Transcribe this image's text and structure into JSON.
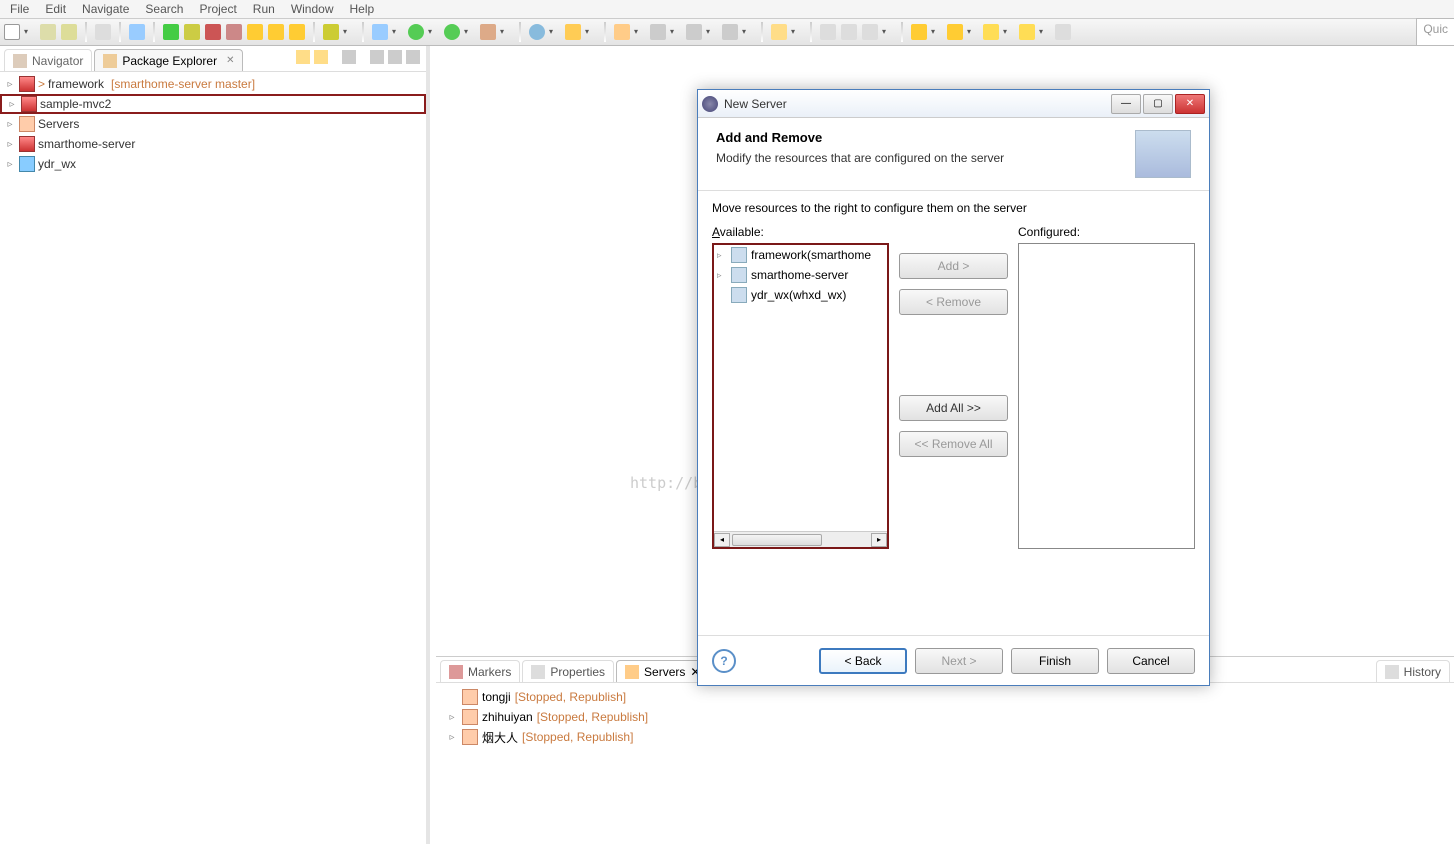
{
  "menu": [
    "File",
    "Edit",
    "Navigate",
    "Search",
    "Project",
    "Run",
    "Window",
    "Help"
  ],
  "quick_placeholder": "Quic",
  "views": {
    "navigator": "Navigator",
    "package_explorer": "Package Explorer"
  },
  "projects": [
    {
      "name": "framework",
      "deco": "[smarthome-server master]",
      "icon": "proj"
    },
    {
      "name": "sample-mvc2",
      "deco": "",
      "icon": "proj",
      "highlight": true
    },
    {
      "name": "Servers",
      "deco": "",
      "icon": "srv"
    },
    {
      "name": "smarthome-server",
      "deco": "",
      "icon": "proj"
    },
    {
      "name": "ydr_wx",
      "deco": "",
      "icon": "war"
    }
  ],
  "bottom_tabs": {
    "markers": "Markers",
    "properties": "Properties",
    "servers": "Servers",
    "history": "History"
  },
  "servers_list": [
    {
      "name": "tongji",
      "status": "[Stopped, Republish]"
    },
    {
      "name": "zhihuiyan",
      "status": "[Stopped, Republish]"
    },
    {
      "name": "烟大人",
      "status": "[Stopped, Republish]"
    }
  ],
  "watermark": "http://blog.csdn.net/",
  "dialog": {
    "title": "New Server",
    "heading": "Add and Remove",
    "subheading": "Modify the resources that are configured on the server",
    "instruction": "Move resources to the right to configure them on the server",
    "available_label": "Available:",
    "configured_label": "Configured:",
    "available": [
      {
        "name": "framework(smarthome",
        "expandable": true
      },
      {
        "name": "smarthome-server",
        "expandable": true
      },
      {
        "name": "ydr_wx(whxd_wx)",
        "expandable": false
      }
    ],
    "btn_add": "Add >",
    "btn_remove": "< Remove",
    "btn_addall": "Add All >>",
    "btn_removeall": "<< Remove All",
    "btn_back": "< Back",
    "btn_next": "Next >",
    "btn_finish": "Finish",
    "btn_cancel": "Cancel"
  }
}
